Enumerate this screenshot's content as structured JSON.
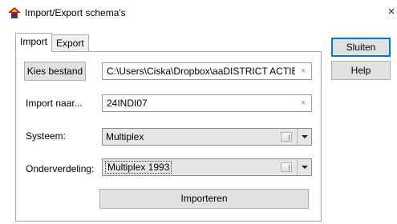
{
  "window": {
    "title": "Import/Export schema's",
    "icon": "app-logo-icon",
    "close_glyph": "×"
  },
  "tabs": [
    {
      "label": "Import",
      "active": true
    },
    {
      "label": "Export",
      "active": false
    }
  ],
  "side_buttons": {
    "close_label": "Sluiten",
    "help_label": "Help"
  },
  "import_panel": {
    "choose_file_label": "Kies bestand",
    "file_path": "C:\\Users\\Ciska\\Dropbox\\aaDISTRICT ACTIEF\\NBB",
    "import_to_label": "Import naar...",
    "import_to_value": "24INDI07",
    "system_label": "Systeem:",
    "system_value": "Multiplex",
    "subdivision_label": "Onderverdeling:",
    "subdivision_value": "Multiplex 1993",
    "import_button_label": "Importeren",
    "clear_glyph": "×"
  },
  "colors": {
    "focus_border": "#0078d7",
    "button_face": "#e1e1e1",
    "combo_face": "#e6e6e6"
  }
}
